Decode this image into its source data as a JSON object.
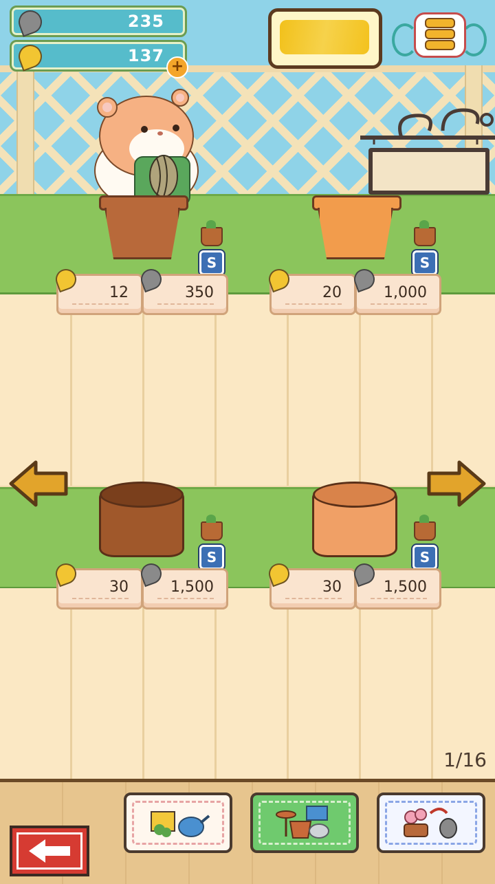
{
  "currency": {
    "silver": {
      "value": "235",
      "icon": "silver-seed-icon"
    },
    "gold": {
      "value": "137",
      "icon": "gold-seed-icon",
      "add_icon": "plus-icon"
    }
  },
  "menu": {
    "icon": "menu-icon"
  },
  "page_indicator": "1/16",
  "items": [
    {
      "name": "brown-clay-pot",
      "gold_price": "12",
      "silver_price": "350",
      "size_badge": "S",
      "color": "#b8693a"
    },
    {
      "name": "orange-clay-pot",
      "gold_price": "20",
      "silver_price": "1,000",
      "size_badge": "S",
      "color": "#f29c4c"
    },
    {
      "name": "brown-stump-planter",
      "gold_price": "30",
      "silver_price": "1,500",
      "size_badge": "S",
      "color": "#a0582b"
    },
    {
      "name": "orange-stump-planter",
      "gold_price": "30",
      "silver_price": "1,500",
      "size_badge": "S",
      "color": "#f0a066"
    }
  ],
  "toolbar": {
    "tools": [
      {
        "icon": "garden-tools-icon"
      },
      {
        "icon": "pots-icon"
      },
      {
        "icon": "flower-exchange-icon"
      }
    ],
    "back_icon": "back-arrow-icon"
  },
  "colors": {
    "gold": "#f2c532",
    "silver": "#8a8a8a",
    "grass": "#8bc55c",
    "badge": "#3c6fb4"
  }
}
